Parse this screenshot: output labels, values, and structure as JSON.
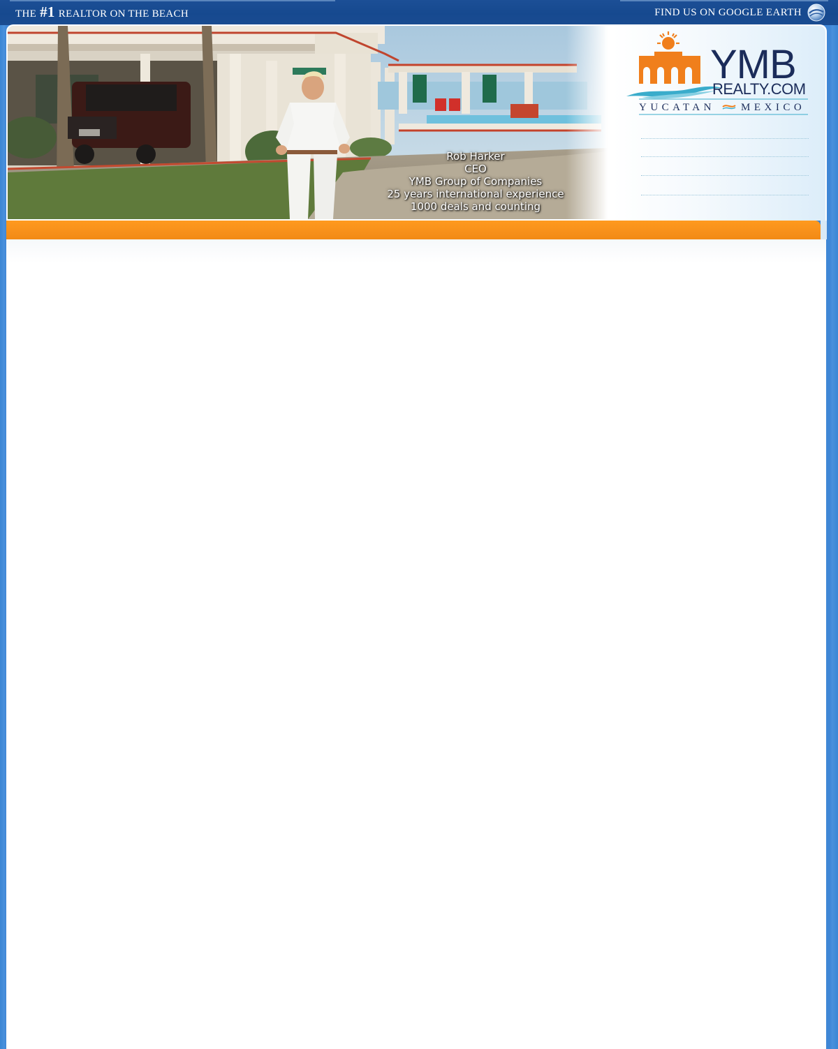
{
  "topbar": {
    "tagline_prefix": "THE",
    "tagline_number": "#1",
    "tagline_suffix": "REALTOR ON THE BEACH",
    "google_earth_label": "FIND US ON GOOGLE EARTH",
    "google_earth_icon": "google-earth-icon"
  },
  "header": {
    "caption": {
      "line1": "Rob Harker",
      "line2": "CEO",
      "line3": "YMB Group of Companies",
      "line4": "25 years international experience",
      "line5": "1000 deals and counting"
    },
    "logo": {
      "brand": "YMB",
      "domain": "REALTY.COM",
      "region_left": "YUCATAN",
      "region_right": "MEXICO"
    }
  },
  "colors": {
    "topbar": "#16498f",
    "page_background": "#3f87d6",
    "accent_orange": "#f7901a",
    "logo_orange": "#f07f1c",
    "logo_navy": "#1b2c5a",
    "logo_teal": "#3aaccb"
  }
}
